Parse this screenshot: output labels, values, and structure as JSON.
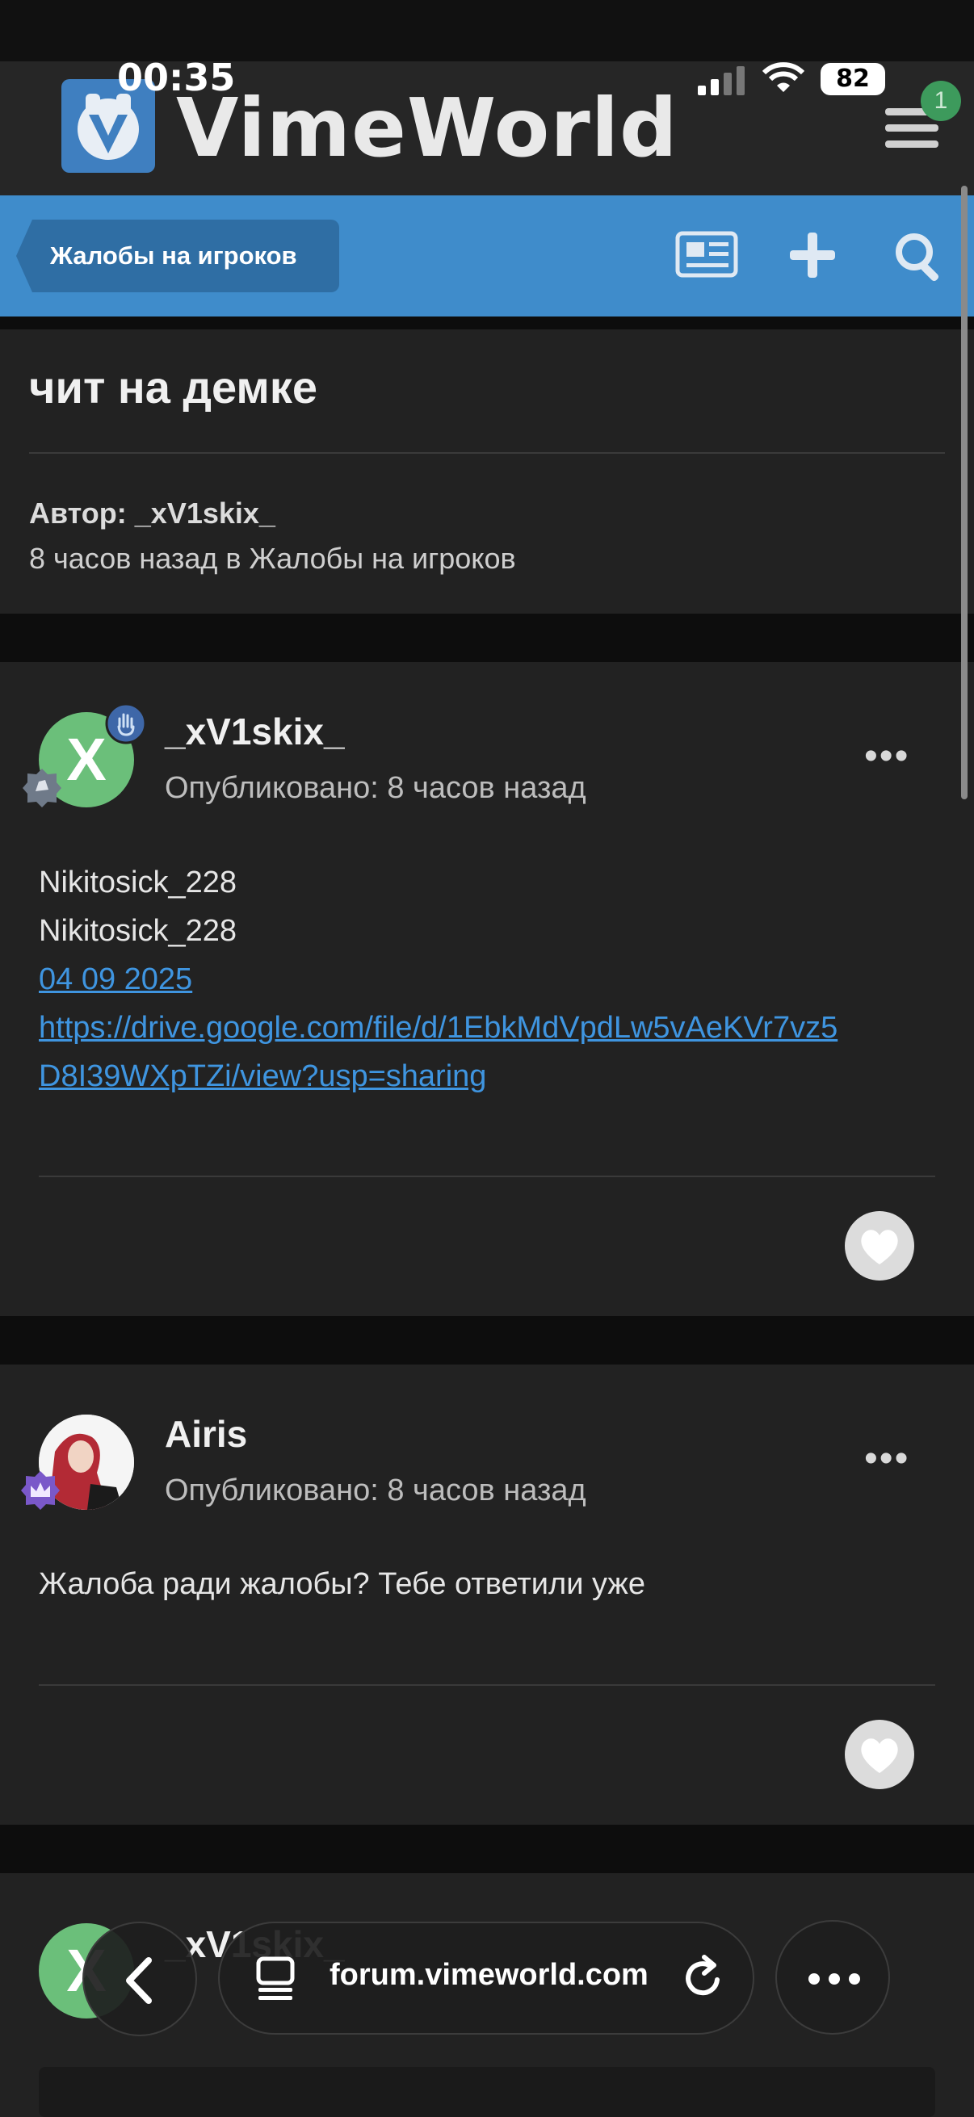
{
  "status_bar": {
    "time": "00:35",
    "battery": "82"
  },
  "header": {
    "logo_text": "VimeWorld",
    "menu_badge": "1"
  },
  "nav": {
    "breadcrumb": "Жалобы на игроков"
  },
  "topic": {
    "title": "чит на демке",
    "author_line": "Автор: _xV1skix_",
    "meta_line": "8 часов назад в Жалобы на игроков"
  },
  "posts": [
    {
      "avatar_letter": "X",
      "username": "_xV1skix_",
      "posted": "Опубликовано: 8 часов назад",
      "lines": [
        "Nikitosick_228",
        "Nikitosick_228"
      ],
      "date_link": "04 09 2025",
      "url_line1": "https://drive.google.com/file/d/1EbkMdVpdLw5vAeKVr7vz5",
      "url_line2": "D8I39WXpTZi/view?usp=sharing"
    },
    {
      "username": "Airis",
      "posted": "Опубликовано: 8 часов назад",
      "text": "Жалоба ради жалобы? Тебе ответили уже"
    },
    {
      "avatar_letter": "X",
      "username": "_xV1skix_"
    }
  ],
  "browser": {
    "url": "forum.vimeworld.com"
  },
  "colors": {
    "accent_blue": "#3f8ccb",
    "card_bg": "#222222",
    "link": "#3f95e0"
  }
}
